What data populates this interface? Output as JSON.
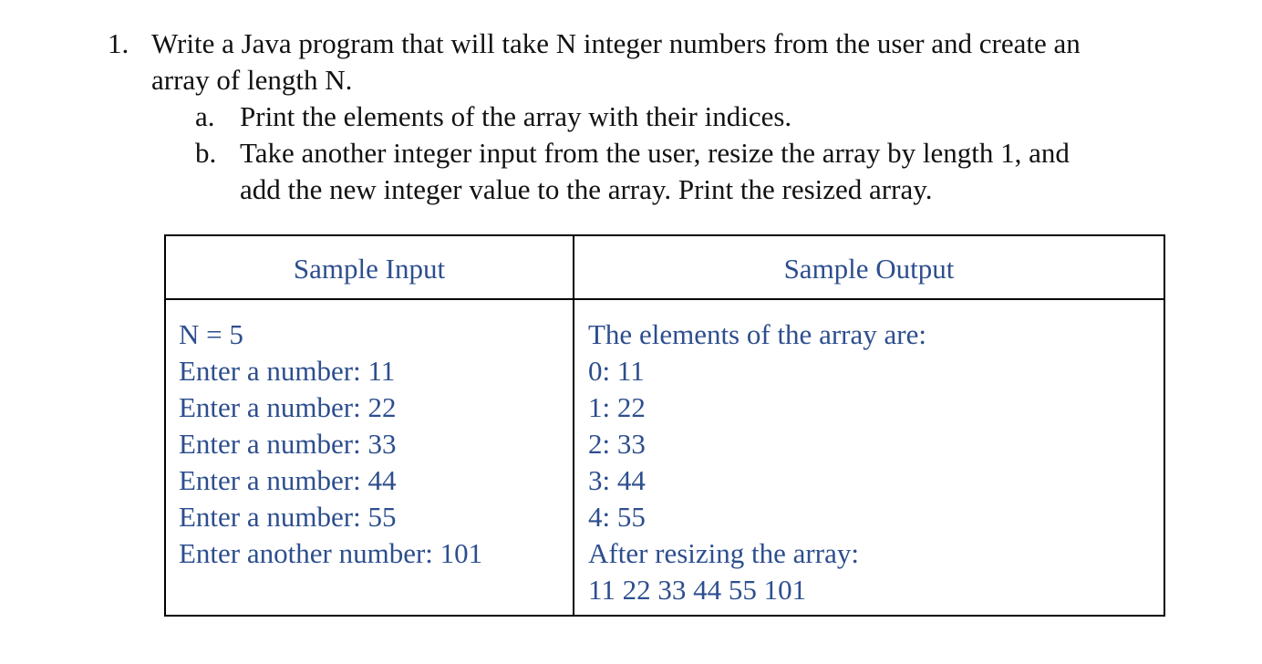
{
  "question": {
    "number": "1.",
    "line1": "Write a Java program that will take N integer numbers from the user and create an",
    "line2": "array of length N.",
    "parts": [
      {
        "marker": "a.",
        "lines": [
          "Print the elements of the array with their indices."
        ]
      },
      {
        "marker": "b.",
        "lines": [
          "Take another integer input from the user, resize the array by length 1, and",
          "add the new integer value to the array. Print the resized array."
        ]
      }
    ]
  },
  "table": {
    "header_input": "Sample Input",
    "header_output": "Sample Output",
    "input_lines": [
      "N = 5",
      "Enter a number: 11",
      "Enter a number: 22",
      "Enter a number: 33",
      "Enter a number: 44",
      "Enter a number: 55",
      "Enter another number: 101"
    ],
    "output_lines": [
      "The elements of the array are:",
      "0: 11",
      "1: 22",
      "2: 33",
      "3: 44",
      "4: 55",
      "After resizing the array:",
      "11 22 33 44 55 101"
    ],
    "text_color": "#2d4e8e"
  }
}
